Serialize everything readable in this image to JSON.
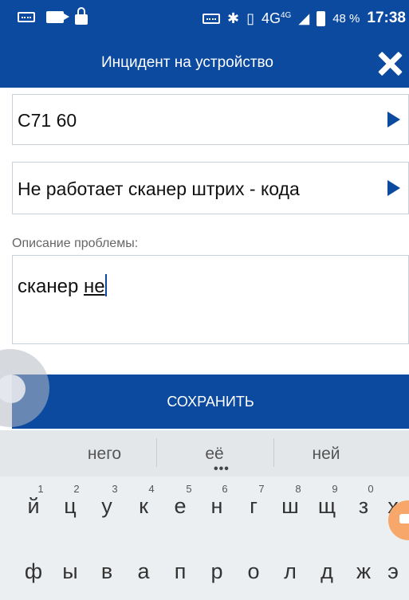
{
  "status_bar": {
    "network": "4G",
    "network_sup": "4G",
    "battery_percent": "48 %",
    "time": "17:38",
    "icons": [
      "keyboard-icon",
      "camera-icon",
      "lock-icon",
      "keyboard-icon",
      "bluetooth-icon",
      "vibrate-icon",
      "signal-icon",
      "battery-icon"
    ]
  },
  "header": {
    "title": "Инцидент на устройство"
  },
  "form": {
    "device_value": "С71 60",
    "problem_value": "Не работает сканер штрих - кода",
    "description_label": "Описание проблемы:",
    "description_text_plain": "сканер ",
    "description_text_underlined": "не"
  },
  "save_button": {
    "label": "СОХРАНИТЬ"
  },
  "keyboard": {
    "suggestions": [
      "него",
      "её",
      "ней"
    ],
    "suggestion_more": "•••",
    "row1": [
      "й",
      "ц",
      "у",
      "к",
      "е",
      "н",
      "г",
      "ш",
      "щ",
      "з",
      "х"
    ],
    "row1_numbers": [
      "1",
      "2",
      "3",
      "4",
      "5",
      "6",
      "7",
      "8",
      "9",
      "0"
    ],
    "row2": [
      "ф",
      "ы",
      "в",
      "а",
      "п",
      "р",
      "о",
      "л",
      "д",
      "ж",
      "э"
    ]
  },
  "colors": {
    "brand_blue": "#0c4aa0",
    "fab_orange": "#f7a76a"
  }
}
